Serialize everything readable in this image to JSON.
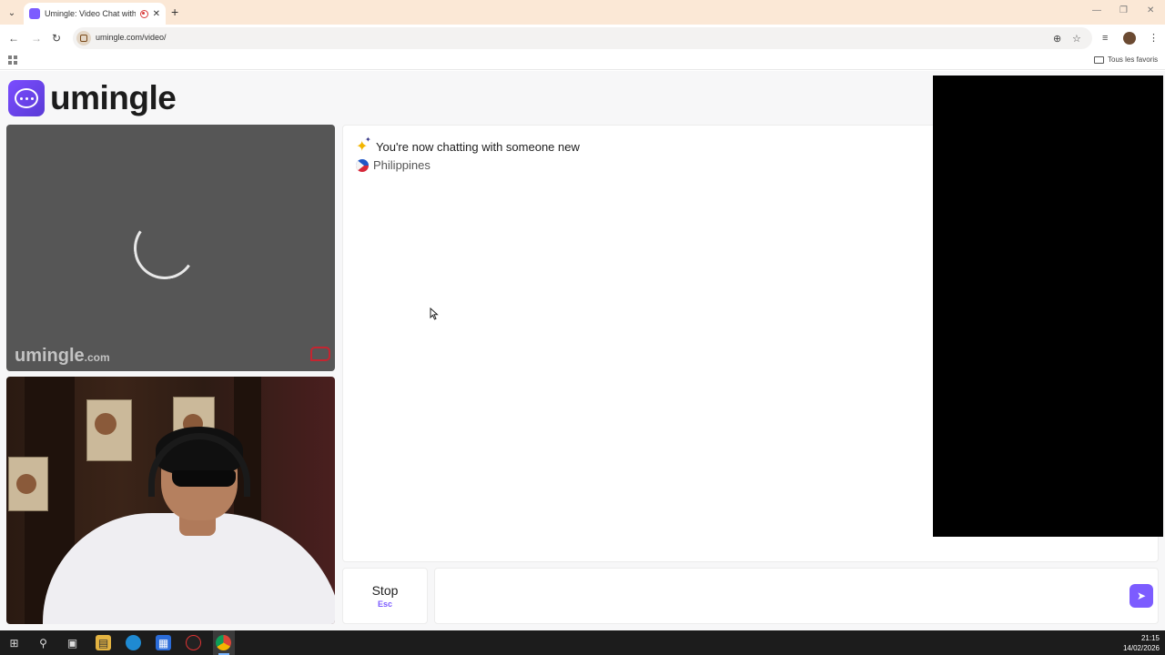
{
  "browser": {
    "tab_title": "Umingle: Video Chat with St",
    "url": "umingle.com/video/",
    "bookmarks_label": "Tous les favoris"
  },
  "site": {
    "logo_text": "umingle",
    "watermark_main": "umingle",
    "watermark_suffix": ".com"
  },
  "chat": {
    "system_message": "You're now chatting with someone new",
    "country": "Philippines"
  },
  "controls": {
    "stop_label": "Stop",
    "stop_hint": "Esc",
    "message_value": ""
  },
  "taskbar": {
    "time": "21:15",
    "date": "14/02/2026"
  },
  "colors": {
    "accent": "#7c5cff",
    "tab_strip": "#fbe8d6",
    "report": "#c52530"
  }
}
